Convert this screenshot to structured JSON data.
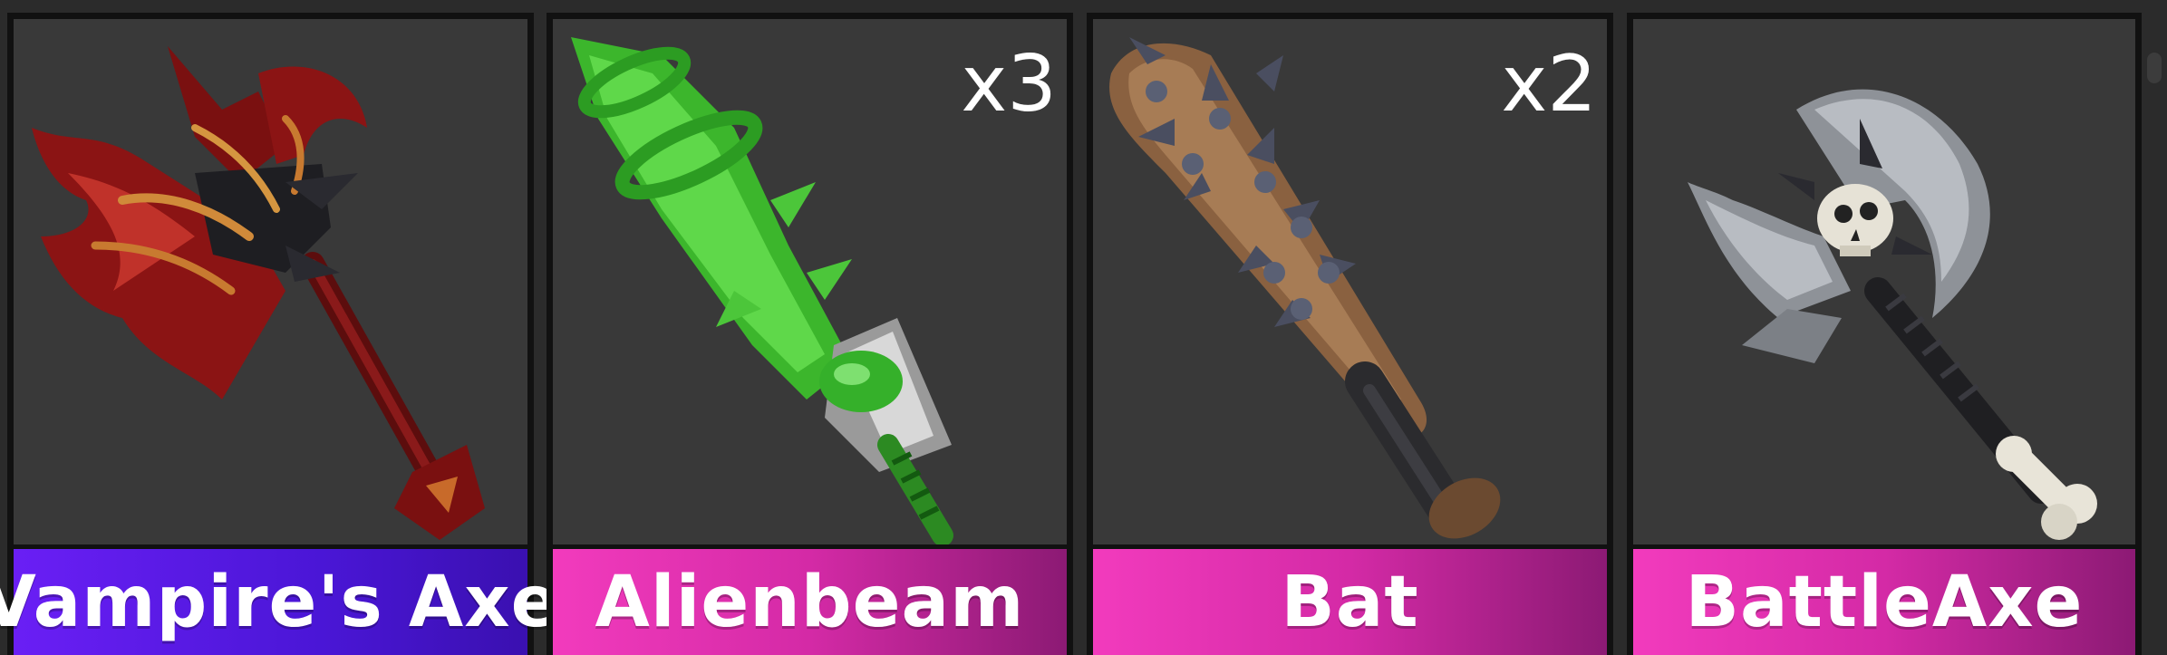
{
  "inventory": {
    "items": [
      {
        "name": "Vampire's Axe",
        "count": "",
        "rarity_color": "#5a1be8",
        "icon": "vampire-axe-icon"
      },
      {
        "name": "Alienbeam",
        "count": "x3",
        "rarity_color": "#e632b7",
        "icon": "alienbeam-icon"
      },
      {
        "name": "Bat",
        "count": "x2",
        "rarity_color": "#e632b7",
        "icon": "spiked-bat-icon"
      },
      {
        "name": "BattleAxe",
        "count": "",
        "rarity_color": "#e632b7",
        "icon": "battle-axe-icon"
      }
    ]
  }
}
